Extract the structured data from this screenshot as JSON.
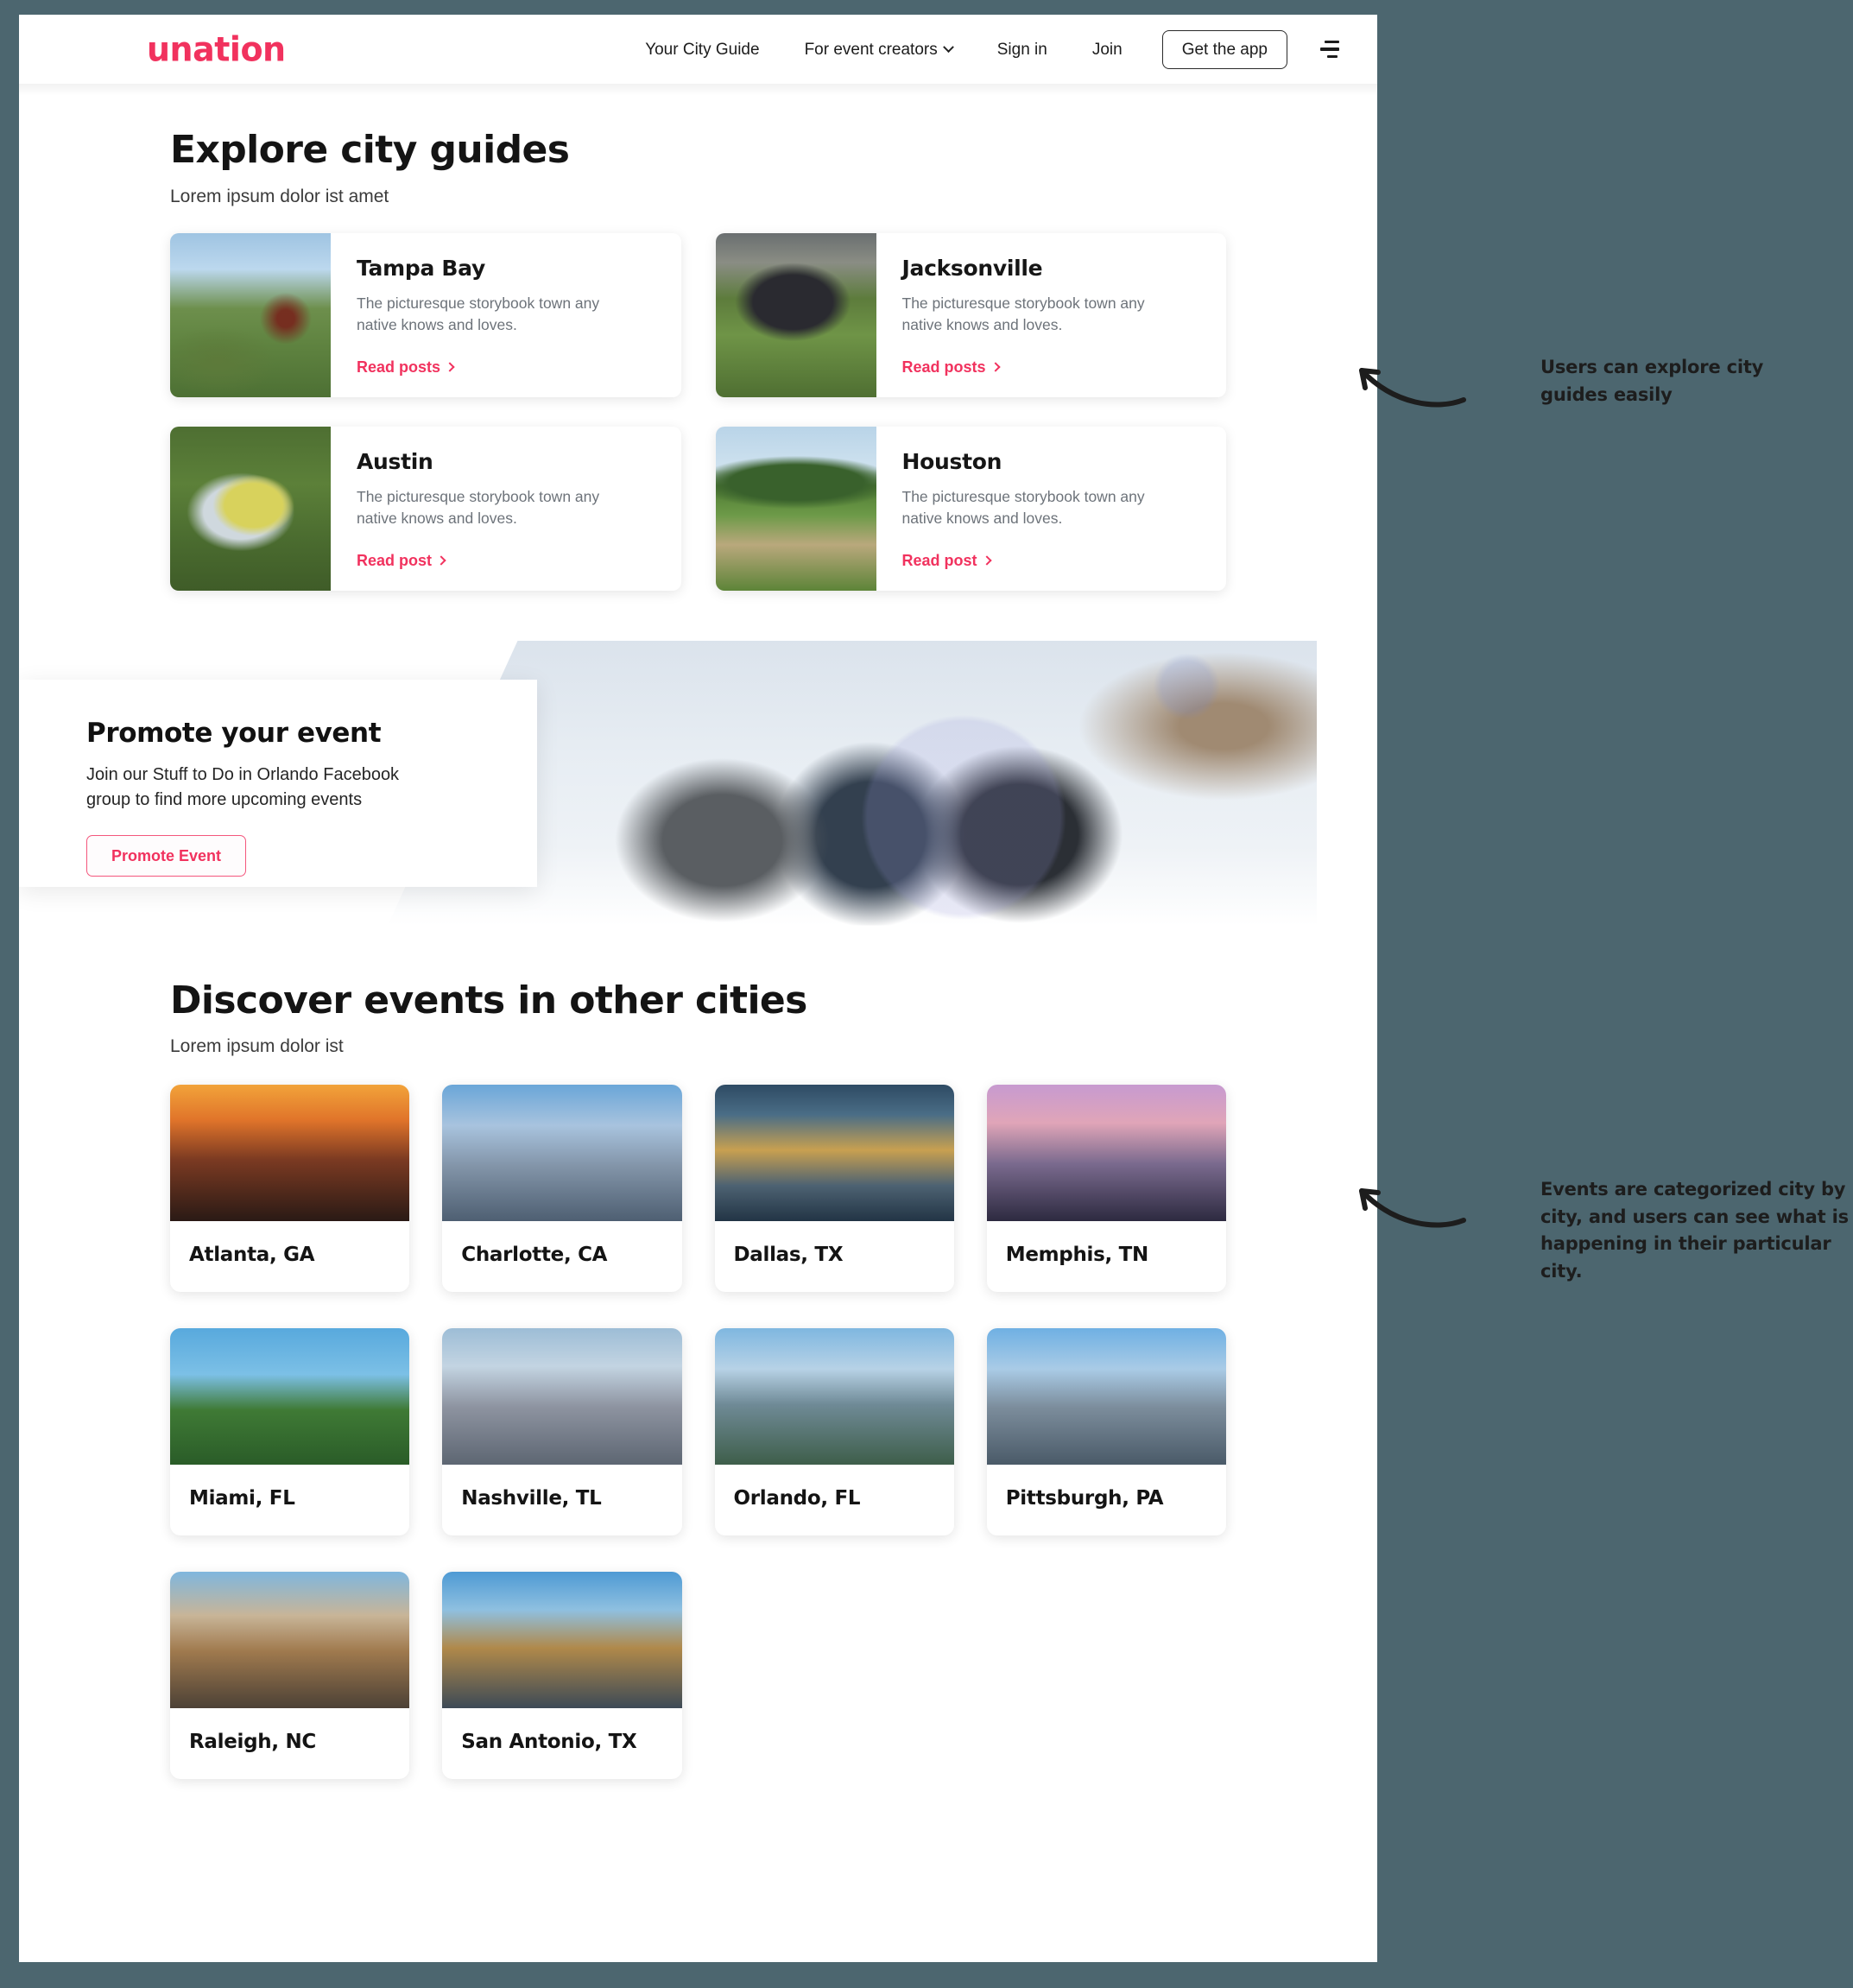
{
  "header": {
    "logo_text": "unation",
    "nav_links": [
      {
        "label": "Your City Guide",
        "has_caret": false
      },
      {
        "label": "For event creators",
        "has_caret": true
      },
      {
        "label": "Sign in",
        "has_caret": false
      },
      {
        "label": "Join",
        "has_caret": false
      }
    ],
    "app_button": "Get the app",
    "menu_icon": "hamburger-icon"
  },
  "explore": {
    "title": "Explore city guides",
    "subtitle": "Lorem ipsum dolor ist amet",
    "cards": [
      {
        "city": "Tampa Bay",
        "description": "The picturesque storybook town any native knows and loves.",
        "link": "Read posts"
      },
      {
        "city": "Jacksonville",
        "description": "The picturesque storybook town any native knows and loves.",
        "link": "Read posts"
      },
      {
        "city": "Austin",
        "description": "The picturesque storybook town any native knows and loves.",
        "link": "Read post"
      },
      {
        "city": "Houston",
        "description": "The picturesque storybook town any native knows and loves.",
        "link": "Read post"
      }
    ]
  },
  "promote": {
    "title": "Promote your event",
    "description": "Join our Stuff to Do in Orlando Facebook group to find more upcoming events",
    "button": "Promote Event"
  },
  "discover": {
    "title": "Discover events in other cities",
    "subtitle": "Lorem ipsum dolor ist",
    "cities": [
      {
        "name": "Atlanta, GA"
      },
      {
        "name": "Charlotte, CA"
      },
      {
        "name": "Dallas, TX"
      },
      {
        "name": "Memphis, TN"
      },
      {
        "name": "Miami, FL"
      },
      {
        "name": "Nashville, TL"
      },
      {
        "name": "Orlando, FL"
      },
      {
        "name": "Pittsburgh, PA"
      },
      {
        "name": "Raleigh, NC"
      },
      {
        "name": "San Antonio, TX"
      }
    ]
  },
  "annotations": [
    {
      "text": "Users can explore city guides easily"
    },
    {
      "text": "Events are categorized city by city, and users can see what is happening in their particular city."
    }
  ],
  "colors": {
    "background": "#4c666f",
    "accent": "#f1325e",
    "page": "#ffffff",
    "heading": "#141414",
    "muted_text": "#6d737a"
  }
}
